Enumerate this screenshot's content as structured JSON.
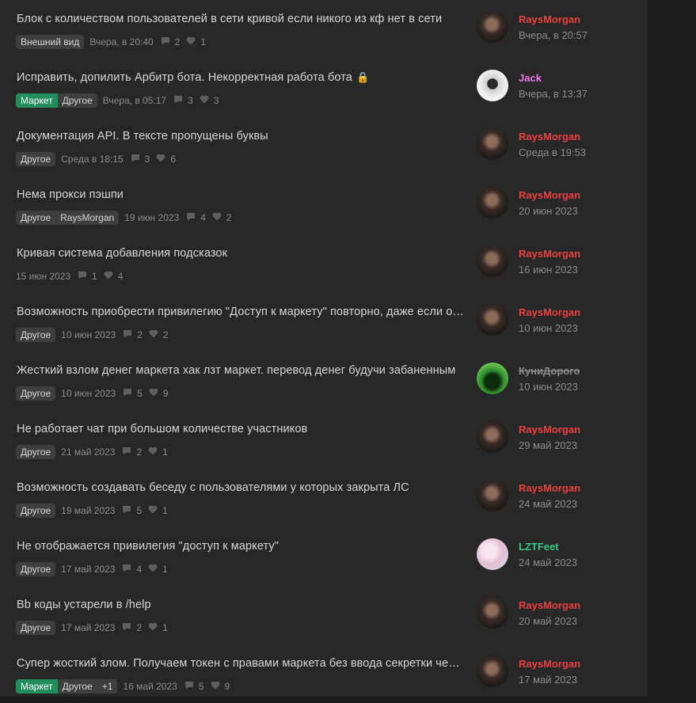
{
  "threads": [
    {
      "title": "Блок с количеством пользователей в сети кривой если никого из кф нет в сети",
      "tags": [
        {
          "label": "Внешний вид",
          "kind": "default"
        }
      ],
      "date": "Вчера, в 20:40",
      "replies": "2",
      "likes": "1",
      "last_user": "RaysMorgan",
      "last_user_style": "red",
      "last_date": "Вчера, в 20:57",
      "avatar": "rays"
    },
    {
      "title": "Исправить, допилить Арбитр бота. Некорректная работа бота",
      "locked": true,
      "tags": [
        {
          "label": "Маркет",
          "kind": "market"
        },
        {
          "label": "Другое",
          "kind": "default"
        }
      ],
      "date": "Вчера, в 05:17",
      "replies": "3",
      "likes": "3",
      "last_user": "Jack",
      "last_user_style": "pink",
      "last_date": "Вчера, в 13:37",
      "avatar": "jack"
    },
    {
      "title": "Документация API. В тексте пропущены буквы",
      "tags": [
        {
          "label": "Другое",
          "kind": "default"
        }
      ],
      "date": "Среда в 18:15",
      "replies": "3",
      "likes": "6",
      "last_user": "RaysMorgan",
      "last_user_style": "red",
      "last_date": "Среда в 19:53",
      "avatar": "rays"
    },
    {
      "title": "Нема прокси пэшпи",
      "tags": [
        {
          "label": "Другое",
          "kind": "default"
        },
        {
          "label": "RaysMorgan",
          "kind": "author"
        }
      ],
      "date": "19 июн 2023",
      "replies": "4",
      "likes": "2",
      "last_user": "RaysMorgan",
      "last_user_style": "red",
      "last_date": "20 июн 2023",
      "avatar": "rays"
    },
    {
      "title": "Кривая система добавления подсказок",
      "tags": [],
      "date": "15 июн 2023",
      "replies": "1",
      "likes": "4",
      "last_user": "RaysMorgan",
      "last_user_style": "red",
      "last_date": "16 июн 2023",
      "avatar": "rays"
    },
    {
      "title": "Возможность приобрести привилегию \"Доступ к маркету\" повторно, даже если она уже была куплена",
      "tags": [
        {
          "label": "Другое",
          "kind": "default"
        }
      ],
      "date": "10 июн 2023",
      "replies": "2",
      "likes": "2",
      "last_user": "RaysMorgan",
      "last_user_style": "red",
      "last_date": "10 июн 2023",
      "avatar": "rays"
    },
    {
      "title": "Жесткий взлом денег маркета хак лзт маркет. перевод денег будучи забаненным",
      "tags": [
        {
          "label": "Другое",
          "kind": "default"
        }
      ],
      "date": "10 июн 2023",
      "replies": "5",
      "likes": "9",
      "last_user": "КуниДорого",
      "last_user_style": "strike",
      "last_date": "10 июн 2023",
      "avatar": "kuni"
    },
    {
      "title": "Не работает чат при большом количестве участников",
      "tags": [
        {
          "label": "Другое",
          "kind": "default"
        }
      ],
      "date": "21 май 2023",
      "replies": "2",
      "likes": "1",
      "last_user": "RaysMorgan",
      "last_user_style": "red",
      "last_date": "29 май 2023",
      "avatar": "rays"
    },
    {
      "title": "Возможность создавать беседу с пользователями у которых закрыта ЛС",
      "tags": [
        {
          "label": "Другое",
          "kind": "default"
        }
      ],
      "date": "19 май 2023",
      "replies": "5",
      "likes": "1",
      "last_user": "RaysMorgan",
      "last_user_style": "red",
      "last_date": "24 май 2023",
      "avatar": "rays"
    },
    {
      "title": "Не отображается привилегия \"доступ к маркету\"",
      "tags": [
        {
          "label": "Другое",
          "kind": "default"
        }
      ],
      "date": "17 май 2023",
      "replies": "4",
      "likes": "1",
      "last_user": "LZTFeet",
      "last_user_style": "green",
      "last_date": "24 май 2023",
      "avatar": "lzt"
    },
    {
      "title": "Bb коды устарели в /help",
      "tags": [
        {
          "label": "Другое",
          "kind": "default"
        }
      ],
      "date": "17 май 2023",
      "replies": "2",
      "likes": "1",
      "last_user": "RaysMorgan",
      "last_user_style": "red",
      "last_date": "20 май 2023",
      "avatar": "rays"
    },
    {
      "title": "Супер жосткий злом. Получаем токен с правами маркета без ввода секретки через API",
      "tags": [
        {
          "label": "Маркет",
          "kind": "market"
        },
        {
          "label": "Другое",
          "kind": "default"
        },
        {
          "label": "+1",
          "kind": "default"
        }
      ],
      "date": "16 май 2023",
      "replies": "5",
      "likes": "9",
      "last_user": "RaysMorgan",
      "last_user_style": "red",
      "last_date": "17 май 2023",
      "avatar": "rays"
    }
  ]
}
